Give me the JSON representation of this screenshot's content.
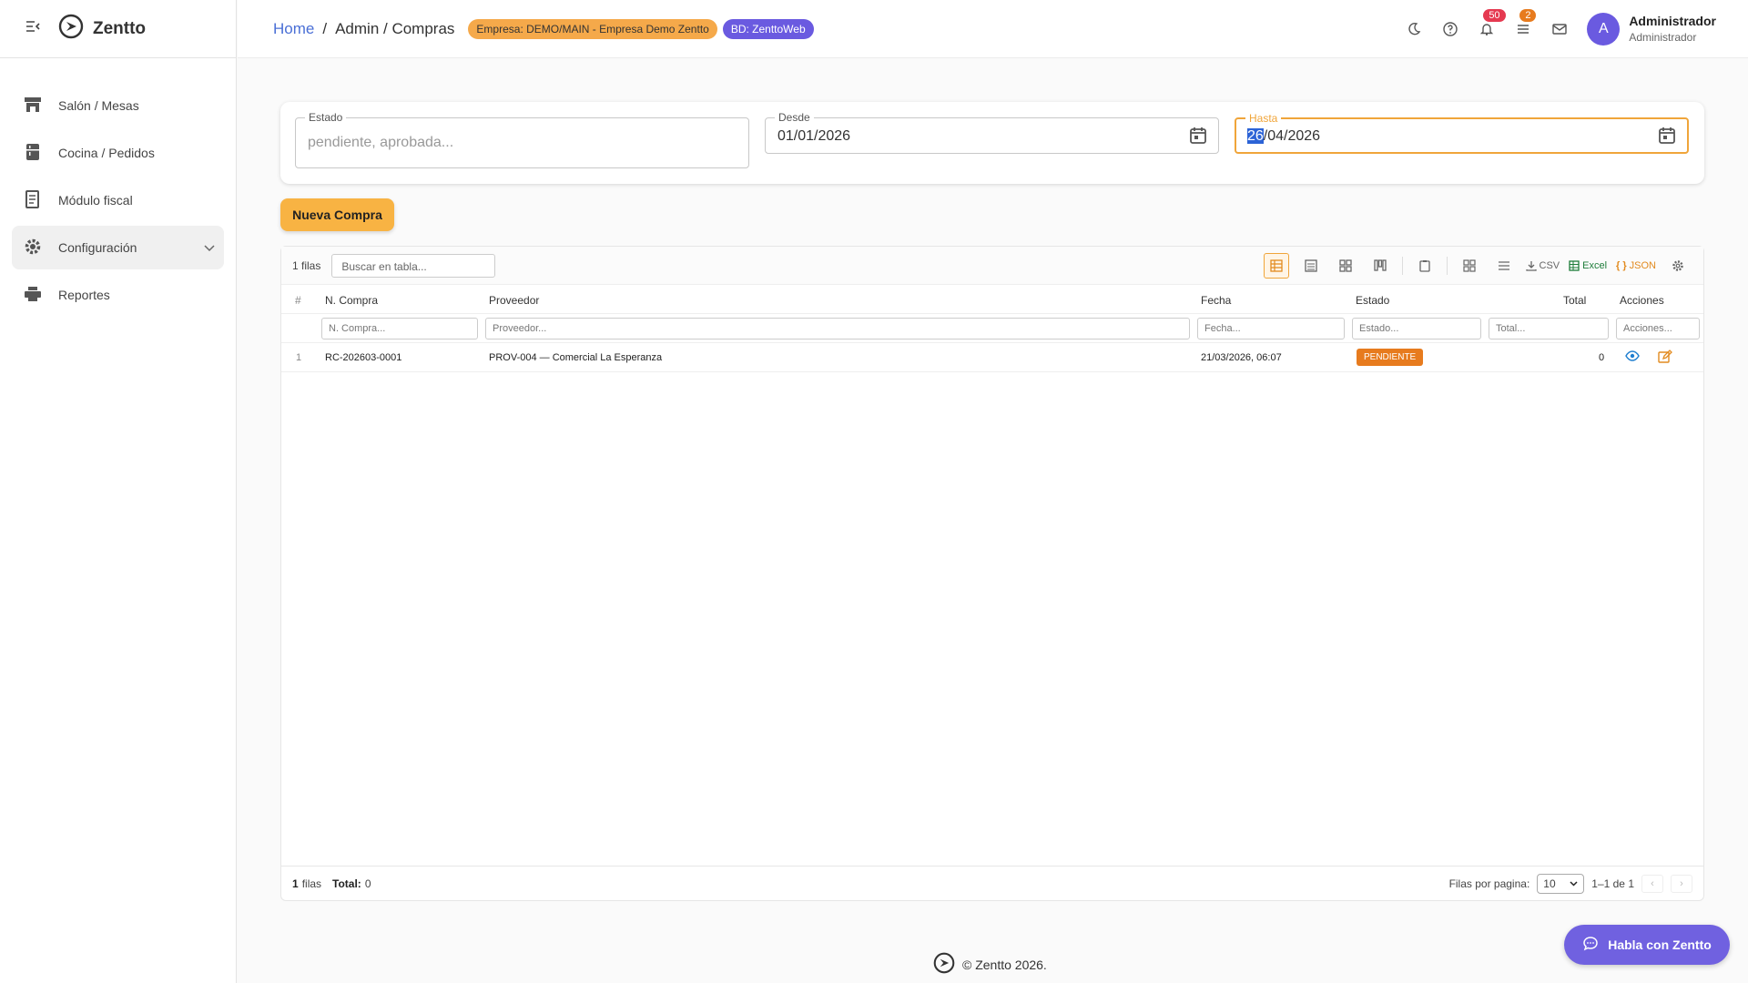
{
  "app": {
    "name": "Zentto",
    "footer": "© Zentto 2026.",
    "chat_label": "Habla con Zentto"
  },
  "sidebar": {
    "items": [
      {
        "label": "Salón / Mesas",
        "icon": "store-icon"
      },
      {
        "label": "Cocina / Pedidos",
        "icon": "kitchen-icon"
      },
      {
        "label": "Módulo fiscal",
        "icon": "receipt-icon"
      },
      {
        "label": "Configuración",
        "icon": "gear-icon"
      },
      {
        "label": "Reportes",
        "icon": "printer-icon"
      }
    ]
  },
  "header": {
    "breadcrumb_home": "Home",
    "breadcrumb_sep": "/",
    "breadcrumb_current": "Admin / Compras",
    "company_badge": "Empresa: DEMO/MAIN - Empresa Demo Zentto",
    "db_badge": "BD: ZenttoWeb",
    "notifications_count": "50",
    "tasks_count": "2",
    "user_name": "Administrador",
    "user_role": "Administrador",
    "avatar_letter": "A"
  },
  "filters": {
    "estado_label": "Estado",
    "estado_placeholder": "pendiente, aprobada...",
    "desde_label": "Desde",
    "desde_value": "01/01/2026",
    "hasta_label": "Hasta",
    "hasta_day": "26",
    "hasta_rest": "/04/2026"
  },
  "actions": {
    "new_purchase": "Nueva Compra"
  },
  "grid": {
    "row_count": "1 filas",
    "search_placeholder": "Buscar en tabla...",
    "export_csv": "CSV",
    "export_excel": "Excel",
    "export_json": "JSON",
    "columns": {
      "num": "#",
      "compra": "N. Compra",
      "proveedor": "Proveedor",
      "fecha": "Fecha",
      "estado": "Estado",
      "total": "Total",
      "acciones": "Acciones"
    },
    "filters": {
      "compra": "N. Compra...",
      "proveedor": "Proveedor...",
      "fecha": "Fecha...",
      "estado": "Estado...",
      "total": "Total...",
      "acciones": "Acciones..."
    },
    "rows": [
      {
        "num": "1",
        "compra": "RC-202603-0001",
        "proveedor": "PROV-004 — Comercial La Esperanza",
        "fecha": "21/03/2026, 06:07",
        "estado": "PENDIENTE",
        "total": "0"
      }
    ],
    "footer": {
      "rows_num": "1",
      "rows_word": "filas",
      "total_label": "Total:",
      "total_value": "0",
      "per_page_label": "Filas por pagina:",
      "per_page_value": "10",
      "range": "1–1 de 1"
    }
  }
}
